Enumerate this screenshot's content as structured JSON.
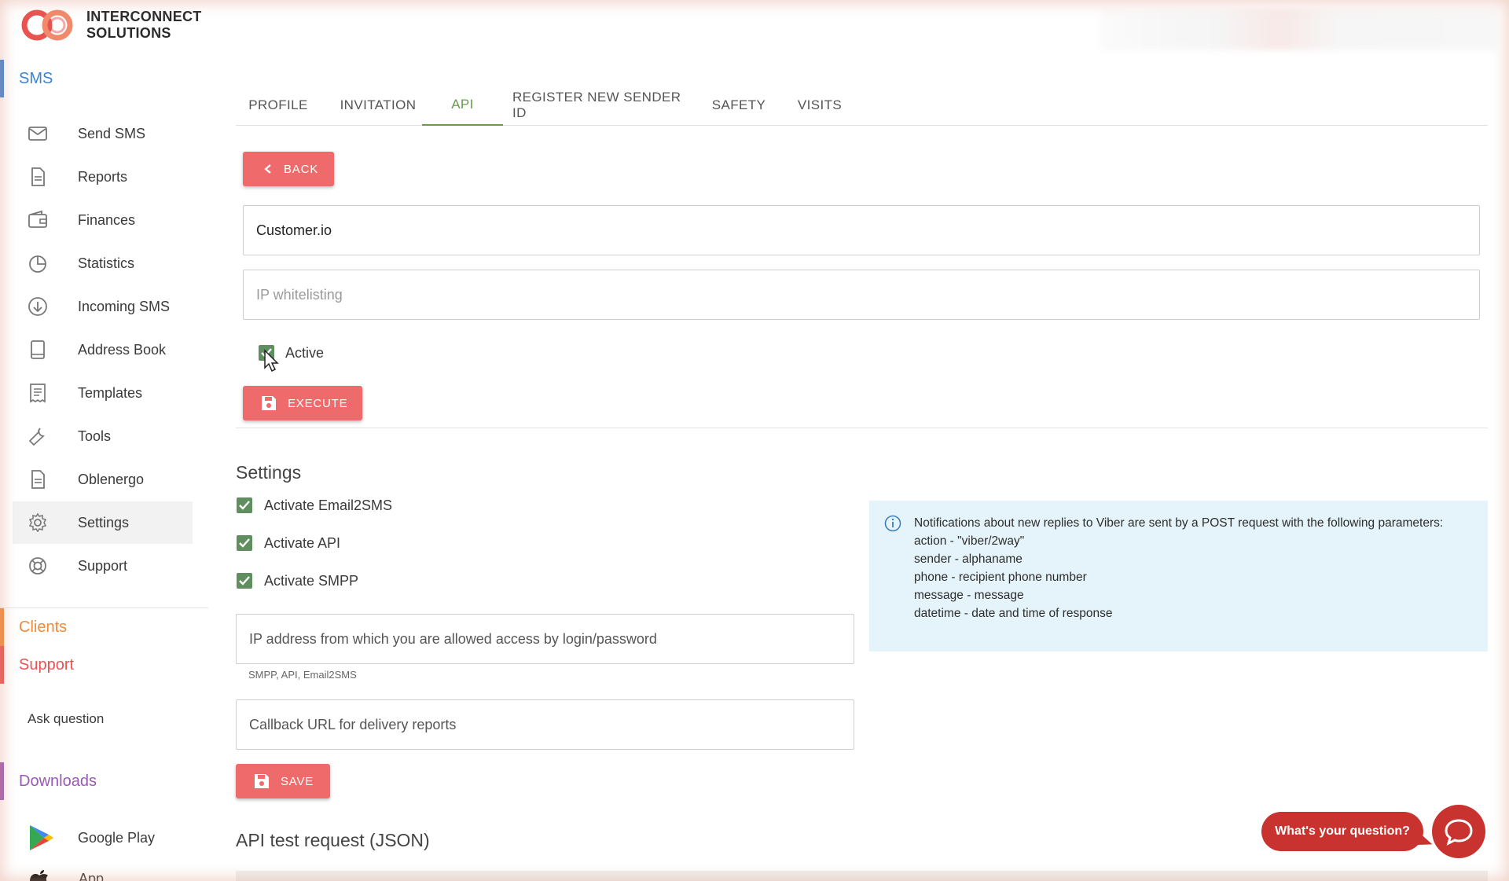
{
  "brand": {
    "name_line1": "INTERCONNECT",
    "name_line2": "SOLUTIONS",
    "colors": {
      "red": "#e8534f",
      "orange": "#f4a261"
    }
  },
  "sidebar": {
    "sms_section": {
      "label": "SMS",
      "color": "#3b82d6"
    },
    "items": [
      {
        "label": "Send SMS",
        "icon": "mail-icon"
      },
      {
        "label": "Reports",
        "icon": "document-icon"
      },
      {
        "label": "Finances",
        "icon": "wallet-icon"
      },
      {
        "label": "Statistics",
        "icon": "pie-chart-icon"
      },
      {
        "label": "Incoming SMS",
        "icon": "download-circle-icon"
      },
      {
        "label": "Address Book",
        "icon": "book-icon"
      },
      {
        "label": "Templates",
        "icon": "receipt-icon"
      },
      {
        "label": "Tools",
        "icon": "wrench-icon"
      },
      {
        "label": "Oblenergo",
        "icon": "document-icon"
      },
      {
        "label": "Settings",
        "icon": "gear-icon",
        "active": true
      },
      {
        "label": "Support",
        "icon": "lifebuoy-icon"
      }
    ],
    "clients_section": {
      "label": "Clients",
      "color": "#f08a3c"
    },
    "support_section": {
      "label": "Support",
      "color": "#e8534f"
    },
    "ask_question": "Ask question",
    "downloads_section": {
      "label": "Downloads",
      "color": "#9b59b6"
    },
    "google_play": "Google Play",
    "app_store_partial": "App Store"
  },
  "tabs": [
    {
      "label": "PROFILE"
    },
    {
      "label": "INVITATION"
    },
    {
      "label": "API",
      "active": true
    },
    {
      "label": "REGISTER NEW SENDER ID"
    },
    {
      "label": "SAFETY"
    },
    {
      "label": "VISITS"
    }
  ],
  "api_form": {
    "back_label": "BACK",
    "name_value": "Customer.io",
    "ip_placeholder": "IP whitelisting",
    "active_label": "Active",
    "active_checked": true,
    "execute_label": "EXECUTE"
  },
  "settings": {
    "heading": "Settings",
    "checks": [
      {
        "label": "Activate Email2SMS",
        "checked": true
      },
      {
        "label": "Activate API",
        "checked": true
      },
      {
        "label": "Activate SMPP",
        "checked": true
      }
    ],
    "ip_access_placeholder": "IP address from which you are allowed access by login/password",
    "ip_helper": "SMPP, API, Email2SMS",
    "callback_placeholder": "Callback URL for delivery reports",
    "save_label": "SAVE"
  },
  "info_box": {
    "lines": [
      "Notifications about new replies to Viber are sent by a POST request with the following parameters:",
      "action - \"viber/2way\"",
      "sender - alphaname",
      "phone - recipient phone number",
      "message - message",
      "datetime - date and time of response"
    ]
  },
  "api_test_heading": "API test request (JSON)",
  "chat": {
    "bubble_text": "What's your question?"
  },
  "accent_colors": {
    "button_red": "#ef6b6b",
    "tab_green": "#6a9a4e",
    "check_green": "#5f8f5f",
    "info_bg": "#e5f3fa"
  }
}
